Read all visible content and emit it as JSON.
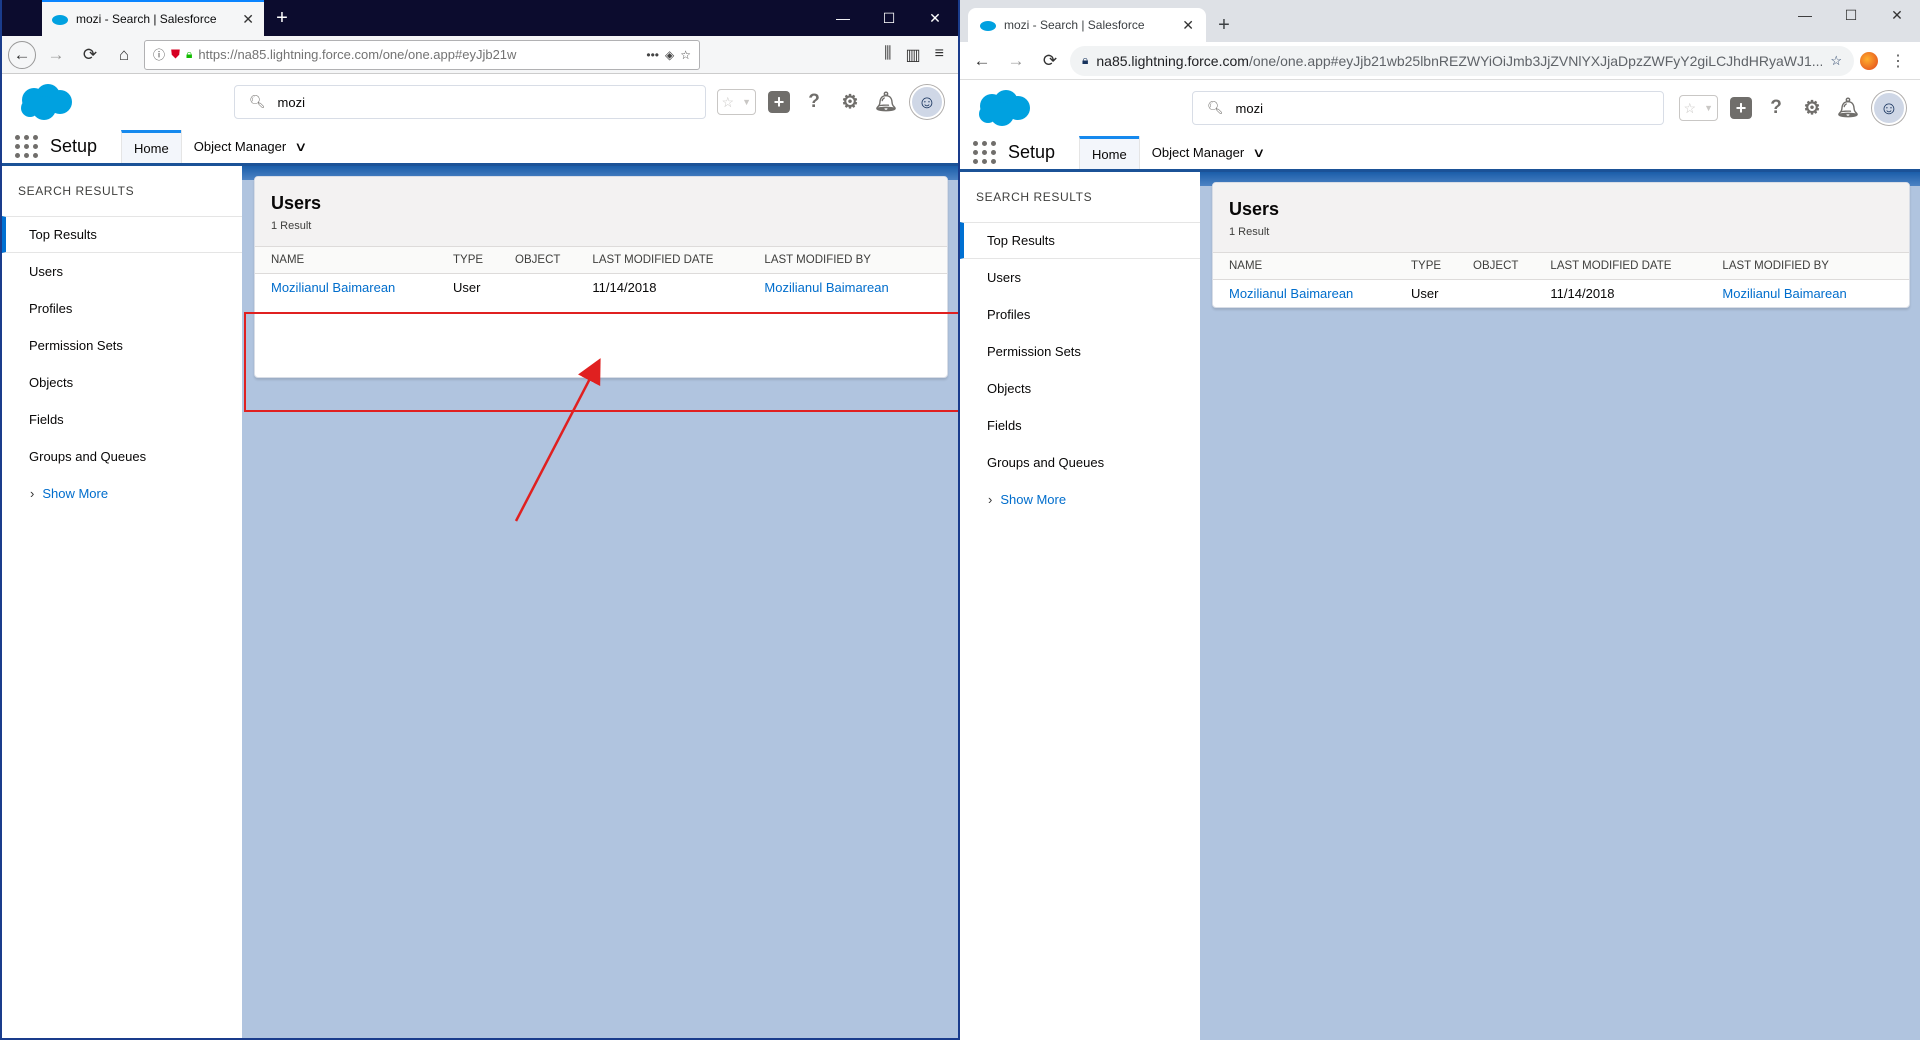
{
  "left_browser": {
    "tab_title": "mozi - Search | Salesforce",
    "url": "https://na85.lightning.force.com/one/one.app#eyJjb21w",
    "window_controls": [
      "—",
      "☐",
      "✕"
    ]
  },
  "right_browser": {
    "tab_title": "mozi - Search | Salesforce",
    "url_domain": "na85.lightning.force.com",
    "url_path": "/one/one.app#eyJjb21wb25lbnREZWYiOiJmb3JjZVNlYXJjaDpzZWFyY2giLCJhdHRyaWJ1...",
    "window_controls": [
      "—",
      "☐",
      "✕"
    ]
  },
  "salesforce": {
    "search_value": "mozi",
    "app_name": "Setup",
    "nav": {
      "home": "Home",
      "object_manager": "Object Manager"
    },
    "sidebar": {
      "heading": "SEARCH RESULTS",
      "items": [
        "Top Results",
        "Users",
        "Profiles",
        "Permission Sets",
        "Objects",
        "Fields",
        "Groups and Queues"
      ],
      "show_more": "Show More"
    },
    "results": {
      "title": "Users",
      "count": "1 Result",
      "columns": [
        "NAME",
        "TYPE",
        "OBJECT",
        "LAST MODIFIED DATE",
        "LAST MODIFIED BY"
      ],
      "rows": [
        {
          "name": "Mozilianul Baimarean",
          "type": "User",
          "object": "",
          "date": "11/14/2018",
          "modified_by": "Mozilianul Baimarean"
        }
      ]
    }
  },
  "colors": {
    "annotation": "#e02020",
    "link": "#006dcc",
    "brand": "#00a1e0"
  },
  "icons": [
    "salesforce-logo-icon",
    "search-icon",
    "star-icon",
    "plus-icon",
    "help-icon",
    "gear-icon",
    "bell-icon",
    "avatar-icon",
    "app-launcher-icon"
  ]
}
